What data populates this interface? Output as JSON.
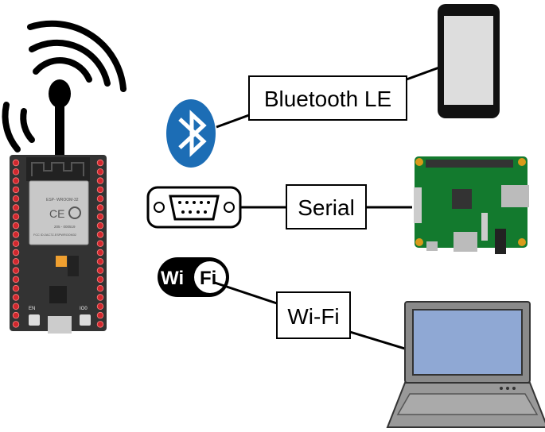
{
  "links": [
    {
      "label": "Bluetooth LE",
      "icon": "bluetooth-icon",
      "device": "smartphone"
    },
    {
      "label": "Serial",
      "icon": "db9-serial-port-icon",
      "device": "raspberry-pi"
    },
    {
      "label": "Wi-Fi",
      "icon": "wifi-logo",
      "device": "laptop"
    }
  ],
  "board": {
    "module_name": "ESP- WROOM-32",
    "cert_code": "205 - 000519",
    "fcc_id": "FCC ID:2AC7Z-ESPWROOM32",
    "button_en": "EN",
    "button_io0": "IO0"
  },
  "wifi_logo": {
    "left": "Wi",
    "right": "Fi"
  },
  "colors": {
    "bluetooth": "#1c6db5",
    "board": "#333333",
    "pins": "#d0282e",
    "pi": "#137a2e",
    "laptop_screen": "#8fa8d4"
  }
}
